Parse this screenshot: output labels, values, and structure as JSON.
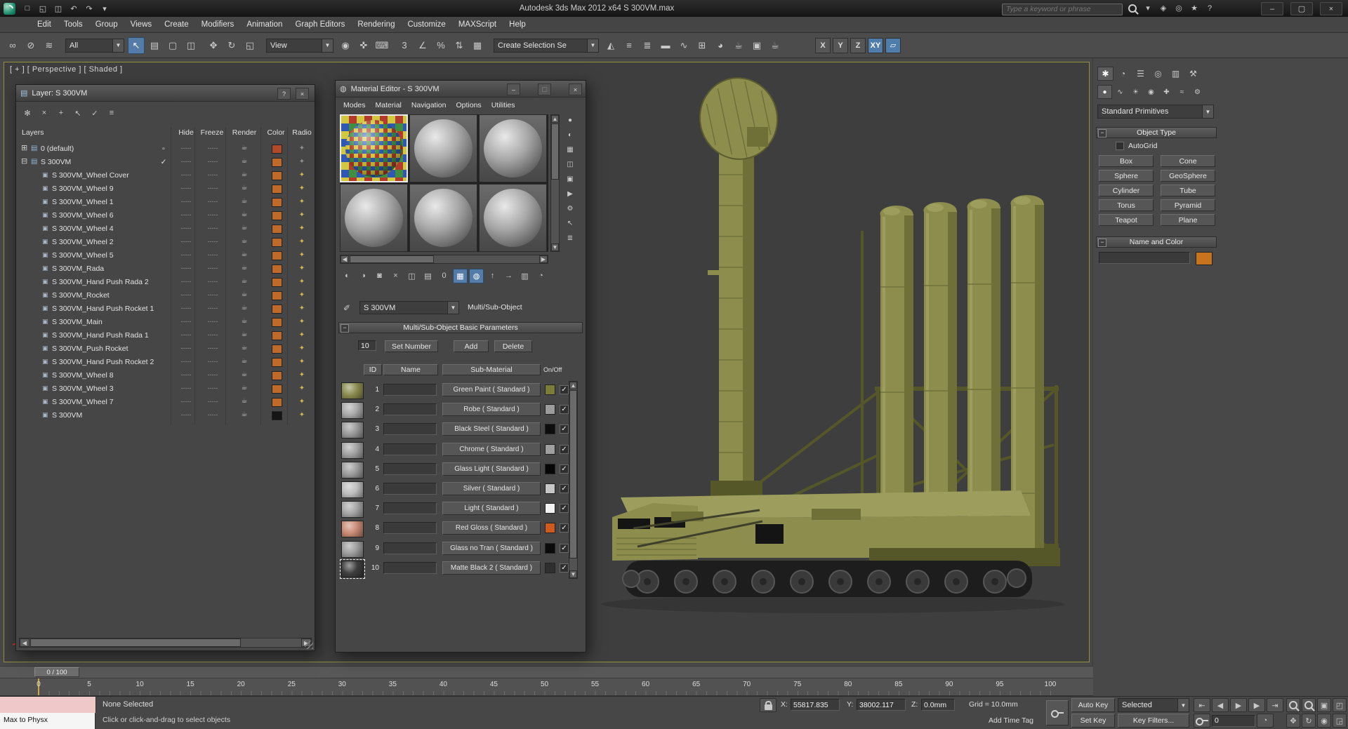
{
  "titlebar": {
    "title": "Autodesk 3ds Max  2012 x64   S 300VM.max",
    "search_placeholder": "Type a keyword or phrase",
    "quick_icons": [
      {
        "name": "new-scene-icon",
        "glyph": "□"
      },
      {
        "name": "open-file-icon",
        "glyph": "◱"
      },
      {
        "name": "save-file-icon",
        "glyph": "◫"
      },
      {
        "name": "undo-icon",
        "glyph": "↶"
      },
      {
        "name": "redo-icon",
        "glyph": "↷"
      },
      {
        "name": "quick-access-menu-icon",
        "glyph": "▾"
      }
    ],
    "info_icons": [
      {
        "name": "search-go-icon",
        "type": "lens"
      },
      {
        "name": "infocenter-dropdown-icon",
        "glyph": "▾"
      },
      {
        "name": "subscription-icon",
        "glyph": "◈"
      },
      {
        "name": "communication-center-icon",
        "glyph": "◎"
      },
      {
        "name": "favorites-icon",
        "glyph": "★"
      },
      {
        "name": "help-icon",
        "glyph": "?"
      }
    ],
    "window_buttons": [
      {
        "name": "minimize-button",
        "glyph": "–"
      },
      {
        "name": "maximize-button",
        "glyph": "▢"
      },
      {
        "name": "close-button",
        "glyph": "×"
      }
    ]
  },
  "menus": [
    "Edit",
    "Tools",
    "Group",
    "Views",
    "Create",
    "Modifiers",
    "Animation",
    "Graph Editors",
    "Rendering",
    "Customize",
    "MAXScript",
    "Help"
  ],
  "toolbar": {
    "icons_a": [
      {
        "name": "select-link-icon",
        "glyph": "∞"
      },
      {
        "name": "unlink-icon",
        "glyph": "⊘"
      },
      {
        "name": "bind-to-spacewarp-icon",
        "glyph": "≋"
      }
    ],
    "selection_filter": "All",
    "icons_b": [
      {
        "name": "select-object-icon",
        "glyph": "↖",
        "active": true
      },
      {
        "name": "select-by-name-icon",
        "glyph": "▤"
      },
      {
        "name": "rectangular-selection-icon",
        "glyph": "▢"
      },
      {
        "name": "window-crossing-icon",
        "glyph": "◫"
      }
    ],
    "icons_c": [
      {
        "name": "select-move-icon",
        "glyph": "✥"
      },
      {
        "name": "select-rotate-icon",
        "glyph": "↻"
      },
      {
        "name": "select-scale-icon",
        "glyph": "◱"
      }
    ],
    "ref_coord": "View",
    "icons_d": [
      {
        "name": "use-pivot-center-icon",
        "glyph": "◉"
      },
      {
        "name": "select-manipulate-icon",
        "glyph": "✜"
      },
      {
        "name": "keyboard-override-icon",
        "glyph": "⌨"
      }
    ],
    "icons_e": [
      {
        "name": "snaps-toggle-icon",
        "glyph": "3"
      },
      {
        "name": "angle-snap-icon",
        "glyph": "∠"
      },
      {
        "name": "percent-snap-icon",
        "glyph": "%"
      },
      {
        "name": "spinner-snap-icon",
        "glyph": "⇅"
      },
      {
        "name": "edit-named-sets-icon",
        "glyph": "▦"
      }
    ],
    "named_selection": "Create Selection Se",
    "icons_f": [
      {
        "name": "mirror-icon",
        "glyph": "◭"
      },
      {
        "name": "align-icon",
        "glyph": "≡"
      },
      {
        "name": "layer-manager-icon",
        "glyph": "≣"
      },
      {
        "name": "graphite-ribbon-icon",
        "glyph": "▬"
      },
      {
        "name": "curve-editor-icon",
        "glyph": "∿"
      },
      {
        "name": "schematic-view-icon",
        "glyph": "⊞"
      },
      {
        "name": "material-editor-icon",
        "glyph": "◕"
      },
      {
        "name": "render-setup-icon",
        "glyph": "☕"
      },
      {
        "name": "rendered-frame-icon",
        "glyph": "▣"
      },
      {
        "name": "render-production-icon",
        "glyph": "☕"
      }
    ],
    "axis": [
      {
        "name": "axis-x-button",
        "label": "X"
      },
      {
        "name": "axis-y-button",
        "label": "Y"
      },
      {
        "name": "axis-z-button",
        "label": "Z"
      },
      {
        "name": "axis-xy-button",
        "label": "XY",
        "active": true
      }
    ],
    "axis_planar": {
      "name": "axis-plane-icon",
      "glyph": "▱",
      "active": true
    }
  },
  "viewport": {
    "label": "[ + ] [ Perspective ] [ Shaded ]",
    "colors": {
      "base": "#8d8e4e",
      "light": "#9d9e5d",
      "dark": "#6f7038",
      "darker": "#565728",
      "track": "#1d1d1d",
      "wheel": "#3a3a3a",
      "shadow": "#353535",
      "window": "#141414"
    }
  },
  "layer_dialog": {
    "title": "Layer: S 300VM",
    "help": "?",
    "close": "×",
    "toolbar_icons": [
      {
        "name": "new-layer-icon",
        "glyph": "✻"
      },
      {
        "name": "delete-layer-icon",
        "glyph": "×"
      },
      {
        "name": "add-selection-to-layer-icon",
        "glyph": "+"
      },
      {
        "name": "select-layer-objects-icon",
        "glyph": "↖"
      },
      {
        "name": "set-current-layer-icon",
        "glyph": "✓"
      },
      {
        "name": "hide-freeze-toggle-icon",
        "glyph": "≡"
      }
    ],
    "columns": [
      "Layers",
      "Hide",
      "Freeze",
      "Render",
      "Color",
      "Radio"
    ],
    "rows": [
      {
        "kind": "layer",
        "expander": "plus",
        "name": "0 (default)",
        "current": "box",
        "color": "#b04a28",
        "radio": "dim"
      },
      {
        "kind": "layer",
        "expander": "minus",
        "name": "S 300VM",
        "current": "check",
        "color": "#c06a2a",
        "radio": "dim"
      },
      {
        "kind": "object",
        "name": "S 300VM_Wheel Cover",
        "color": "#c06a2a",
        "radio": "gold"
      },
      {
        "kind": "object",
        "name": "S 300VM_Wheel 9",
        "color": "#c06a2a",
        "radio": "gold"
      },
      {
        "kind": "object",
        "name": "S 300VM_Wheel 1",
        "color": "#c06a2a",
        "radio": "gold"
      },
      {
        "kind": "object",
        "name": "S 300VM_Wheel 6",
        "color": "#c06a2a",
        "radio": "gold"
      },
      {
        "kind": "object",
        "name": "S 300VM_Wheel 4",
        "color": "#c06a2a",
        "radio": "gold"
      },
      {
        "kind": "object",
        "name": "S 300VM_Wheel 2",
        "color": "#c06a2a",
        "radio": "gold"
      },
      {
        "kind": "object",
        "name": "S 300VM_Wheel 5",
        "color": "#c06a2a",
        "radio": "gold"
      },
      {
        "kind": "object",
        "name": "S 300VM_Rada",
        "color": "#c06a2a",
        "radio": "gold"
      },
      {
        "kind": "object",
        "name": "S 300VM_Hand Push Rada 2",
        "color": "#c06a2a",
        "radio": "gold"
      },
      {
        "kind": "object",
        "name": "S 300VM_Rocket",
        "color": "#c06a2a",
        "radio": "gold"
      },
      {
        "kind": "object",
        "name": "S 300VM_Hand Push Rocket 1",
        "color": "#c06a2a",
        "radio": "gold"
      },
      {
        "kind": "object",
        "name": "S 300VM_Main",
        "color": "#c06a2a",
        "radio": "gold"
      },
      {
        "kind": "object",
        "name": "S 300VM_Hand Push Rada 1",
        "color": "#c06a2a",
        "radio": "gold"
      },
      {
        "kind": "object",
        "name": "S 300VM_Push Rocket",
        "color": "#c06a2a",
        "radio": "gold"
      },
      {
        "kind": "object",
        "name": "S 300VM_Hand Push Rocket 2",
        "color": "#c06a2a",
        "radio": "gold"
      },
      {
        "kind": "object",
        "name": "S 300VM_Wheel 8",
        "color": "#c06a2a",
        "radio": "gold"
      },
      {
        "kind": "object",
        "name": "S 300VM_Wheel 3",
        "color": "#c06a2a",
        "radio": "gold"
      },
      {
        "kind": "object",
        "name": "S 300VM_Wheel 7",
        "color": "#c06a2a",
        "radio": "gold"
      },
      {
        "kind": "object",
        "name": "S 300VM",
        "color": "#151515",
        "radio": "gold"
      }
    ]
  },
  "material_editor": {
    "title": "Material Editor - S 300VM",
    "menus": [
      "Modes",
      "Material",
      "Navigation",
      "Options",
      "Utilities"
    ],
    "window_buttons": [
      {
        "name": "minimize-button",
        "glyph": "–"
      },
      {
        "name": "maximize-button",
        "glyph": "▢"
      },
      {
        "name": "close-button",
        "glyph": "×"
      }
    ],
    "slots": [
      {
        "name": "sample-slot-1",
        "style": "checker",
        "selected": true
      },
      {
        "name": "sample-slot-2",
        "style": "sphere"
      },
      {
        "name": "sample-slot-3",
        "style": "sphere"
      },
      {
        "name": "sample-slot-4",
        "style": "sphere"
      },
      {
        "name": "sample-slot-5",
        "style": "sphere"
      },
      {
        "name": "sample-slot-6",
        "style": "sphere"
      }
    ],
    "side_icons": [
      {
        "name": "sample-type-icon",
        "glyph": "●"
      },
      {
        "name": "backlight-icon",
        "glyph": "◐"
      },
      {
        "name": "background-icon",
        "glyph": "▦"
      },
      {
        "name": "sample-tiling-icon",
        "glyph": "◫"
      },
      {
        "name": "video-color-check-icon",
        "glyph": "▣"
      },
      {
        "name": "make-preview-icon",
        "glyph": "▶"
      },
      {
        "name": "options-icon",
        "glyph": "⚙"
      },
      {
        "name": "select-by-material-icon",
        "glyph": "↖"
      },
      {
        "name": "material-map-navigator-icon",
        "glyph": "≣"
      }
    ],
    "toolbar_icons": [
      {
        "name": "get-material-icon",
        "glyph": "◐"
      },
      {
        "name": "put-material-icon",
        "glyph": "◑"
      },
      {
        "name": "assign-material-icon",
        "glyph": "◙"
      },
      {
        "name": "reset-map-icon",
        "glyph": "×"
      },
      {
        "name": "make-unique-icon",
        "glyph": "◫"
      },
      {
        "name": "put-to-library-icon",
        "glyph": "▤"
      },
      {
        "name": "material-id-channel-icon",
        "glyph": "0"
      },
      {
        "name": "show-map-viewport-icon",
        "glyph": "▦",
        "active": true
      },
      {
        "name": "show-end-result-icon",
        "glyph": "◍",
        "active": true
      },
      {
        "name": "go-to-parent-icon",
        "glyph": "↑"
      },
      {
        "name": "go-forward-sibling-icon",
        "glyph": "→"
      },
      {
        "name": "sample-ui-icon",
        "glyph": "▥"
      },
      {
        "name": "material-navigator-icon",
        "glyph": "◔"
      }
    ],
    "eyedropper": {
      "name": "pick-from-object-icon",
      "glyph": "✐"
    },
    "name_value": "S 300VM",
    "type_label": "Multi/Sub-Object",
    "rollout_title": "Multi/Sub-Object Basic Parameters",
    "count": "10",
    "btn_set_number": "Set Number",
    "btn_add": "Add",
    "btn_delete": "Delete",
    "col_id": "ID",
    "col_name": "Name",
    "col_sub": "Sub-Material",
    "col_onoff": "On/Off",
    "rows": [
      {
        "id": "1",
        "label": "Green Paint ( Standard )",
        "preview": "#8a8b4f",
        "swatch": "#7b7c37",
        "on": true
      },
      {
        "id": "2",
        "label": "Robe ( Standard )",
        "preview": "#a9a9a9",
        "swatch": "#9b9b9b",
        "on": true
      },
      {
        "id": "3",
        "label": "Black Steel ( Standard )",
        "preview": "#999999",
        "swatch": "#0d0d0d",
        "on": true
      },
      {
        "id": "4",
        "label": "Chrome ( Standard )",
        "preview": "#a2a2a2",
        "swatch": "#9f9f9f",
        "on": true
      },
      {
        "id": "5",
        "label": "Glass Light ( Standard )",
        "preview": "#9c9c9c",
        "swatch": "#060606",
        "on": true
      },
      {
        "id": "6",
        "label": "Silver ( Standard )",
        "preview": "#bdbdbd",
        "swatch": "#c6c6c6",
        "on": true
      },
      {
        "id": "7",
        "label": "Light ( Standard )",
        "preview": "#a5a5a5",
        "swatch": "#f2f2f2",
        "on": true
      },
      {
        "id": "8",
        "label": "Red Gloss ( Standard )",
        "preview": "#c98a74",
        "swatch": "#cf5a1e",
        "on": true
      },
      {
        "id": "9",
        "label": "Glass no Tran ( Standard )",
        "preview": "#9c9c9c",
        "swatch": "#0a0a0a",
        "on": true
      },
      {
        "id": "10",
        "label": "Matte Black 2 ( Standard )",
        "preview": "#3e3e3e",
        "swatch": "#2f2f2f",
        "on": true,
        "selected": true
      }
    ]
  },
  "command_panel": {
    "tabs": [
      {
        "name": "tab-create",
        "glyph": "✱",
        "active": true
      },
      {
        "name": "tab-modify",
        "glyph": "◔"
      },
      {
        "name": "tab-hierarchy",
        "glyph": "☰"
      },
      {
        "name": "tab-motion",
        "glyph": "◎"
      },
      {
        "name": "tab-display",
        "glyph": "▥"
      },
      {
        "name": "tab-utilities",
        "glyph": "⚒"
      }
    ],
    "subtabs": [
      {
        "name": "subtab-geometry",
        "glyph": "●",
        "active": true
      },
      {
        "name": "subtab-shapes",
        "glyph": "∿"
      },
      {
        "name": "subtab-lights",
        "glyph": "☀"
      },
      {
        "name": "subtab-cameras",
        "glyph": "◉"
      },
      {
        "name": "subtab-helpers",
        "glyph": "✚"
      },
      {
        "name": "subtab-spacewarps",
        "glyph": "≈"
      },
      {
        "name": "subtab-systems",
        "glyph": "⚙"
      }
    ],
    "category_dropdown": "Standard Primitives",
    "object_type": {
      "title": "Object Type",
      "autogrid_label": "AutoGrid",
      "buttons": [
        "Box",
        "Cone",
        "Sphere",
        "GeoSphere",
        "Cylinder",
        "Tube",
        "Torus",
        "Pyramid",
        "Teapot",
        "Plane"
      ]
    },
    "name_color": {
      "title": "Name and Color",
      "swatch_color": "#c8741f"
    }
  },
  "timeline": {
    "slider_label": "0 / 100",
    "min": 0,
    "max": 100,
    "label_step": 5
  },
  "statusbar": {
    "listener_text": "Max to Physx",
    "status": "None Selected",
    "prompt": "Click or click-and-drag to select objects",
    "lock": {
      "name": "selection-lock-toggle",
      "type": "lock"
    },
    "x_label": "X:",
    "x_value": "55817.835",
    "y_label": "Y:",
    "y_value": "38002.117",
    "z_label": "Z:",
    "z_value": "0.0mm",
    "grid_label": "Grid = 10.0mm",
    "time_tag": "Add Time Tag",
    "auto_key": "Auto Key",
    "set_key": "Set Key",
    "selected_filter": "Selected",
    "key_filters": "Key Filters...",
    "frame_value": "0",
    "set_keys_button": {
      "name": "set-keys-button",
      "type": "key"
    },
    "playback": [
      {
        "name": "go-to-start-button",
        "glyph": "⇤"
      },
      {
        "name": "previous-frame-button",
        "glyph": "◀"
      },
      {
        "name": "play-button",
        "glyph": "▶"
      },
      {
        "name": "next-frame-button",
        "glyph": "▶"
      },
      {
        "name": "go-to-end-button",
        "glyph": "⇥"
      }
    ],
    "anim_row2": [
      {
        "name": "key-mode-toggle",
        "type": "key"
      },
      {
        "name": "time-config-icon",
        "glyph": "◔"
      }
    ],
    "nav_row1": [
      {
        "name": "zoom-icon",
        "type": "lens"
      },
      {
        "name": "zoom-all-icon",
        "type": "lens"
      },
      {
        "name": "zoom-extents-icon",
        "glyph": "▣"
      },
      {
        "name": "zoom-region-icon",
        "glyph": "◰"
      },
      {
        "name": "pan-icon",
        "glyph": "✥"
      },
      {
        "name": "orbit-icon",
        "glyph": "↻"
      },
      {
        "name": "fov-icon",
        "glyph": "◉"
      },
      {
        "name": "maximize-viewport-icon",
        "glyph": "◲"
      }
    ]
  }
}
